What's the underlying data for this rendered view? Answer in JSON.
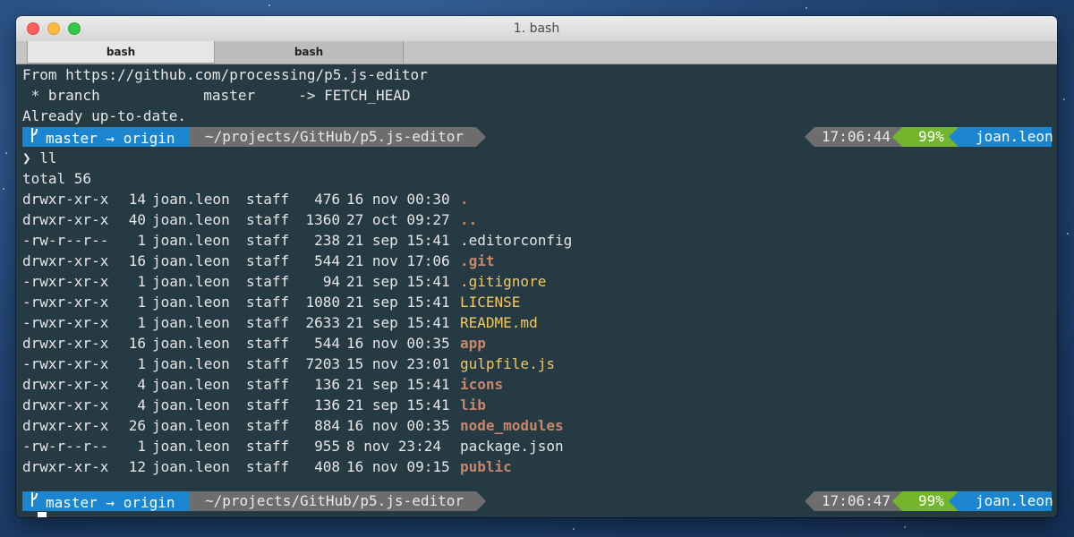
{
  "window": {
    "title": "1. bash"
  },
  "tabs": [
    {
      "label": "bash",
      "active": true
    },
    {
      "label": "bash",
      "active": false
    }
  ],
  "terminal": {
    "git_output": [
      "From https://github.com/processing/p5.js-editor",
      " * branch            master     -> FETCH_HEAD",
      "Already up-to-date."
    ],
    "prompt1": {
      "branch": "master → origin",
      "path": "~/projects/GitHub/p5.js-editor",
      "time": "17:06:44",
      "battery": "99%",
      "user": "joan.leon"
    },
    "command": {
      "arrow": "❯",
      "text": "ll"
    },
    "total": "total 56",
    "listing": [
      {
        "perm": "drwxr-xr-x",
        "links": "14",
        "owner": "joan.leon",
        "group": "staff",
        "size": "476",
        "date": "16 nov 00:30",
        "name": ".",
        "kind": "dir"
      },
      {
        "perm": "drwxr-xr-x",
        "links": "40",
        "owner": "joan.leon",
        "group": "staff",
        "size": "1360",
        "date": "27 oct 09:27",
        "name": "..",
        "kind": "dir"
      },
      {
        "perm": "-rw-r--r--",
        "links": "1",
        "owner": "joan.leon",
        "group": "staff",
        "size": "238",
        "date": "21 sep 15:41",
        "name": ".editorconfig",
        "kind": "plain"
      },
      {
        "perm": "drwxr-xr-x",
        "links": "16",
        "owner": "joan.leon",
        "group": "staff",
        "size": "544",
        "date": "21 nov 17:06",
        "name": ".git",
        "kind": "dir"
      },
      {
        "perm": "-rwxr-xr-x",
        "links": "1",
        "owner": "joan.leon",
        "group": "staff",
        "size": "94",
        "date": "21 sep 15:41",
        "name": ".gitignore",
        "kind": "exe"
      },
      {
        "perm": "-rwxr-xr-x",
        "links": "1",
        "owner": "joan.leon",
        "group": "staff",
        "size": "1080",
        "date": "21 sep 15:41",
        "name": "LICENSE",
        "kind": "exe"
      },
      {
        "perm": "-rwxr-xr-x",
        "links": "1",
        "owner": "joan.leon",
        "group": "staff",
        "size": "2633",
        "date": "21 sep 15:41",
        "name": "README.md",
        "kind": "exe"
      },
      {
        "perm": "drwxr-xr-x",
        "links": "16",
        "owner": "joan.leon",
        "group": "staff",
        "size": "544",
        "date": "16 nov 00:35",
        "name": "app",
        "kind": "dir"
      },
      {
        "perm": "-rwxr-xr-x",
        "links": "1",
        "owner": "joan.leon",
        "group": "staff",
        "size": "7203",
        "date": "15 nov 23:01",
        "name": "gulpfile.js",
        "kind": "exe"
      },
      {
        "perm": "drwxr-xr-x",
        "links": "4",
        "owner": "joan.leon",
        "group": "staff",
        "size": "136",
        "date": "21 sep 15:41",
        "name": "icons",
        "kind": "dir"
      },
      {
        "perm": "drwxr-xr-x",
        "links": "4",
        "owner": "joan.leon",
        "group": "staff",
        "size": "136",
        "date": "21 sep 15:41",
        "name": "lib",
        "kind": "dir"
      },
      {
        "perm": "drwxr-xr-x",
        "links": "26",
        "owner": "joan.leon",
        "group": "staff",
        "size": "884",
        "date": "16 nov 00:35",
        "name": "node_modules",
        "kind": "dir"
      },
      {
        "perm": "-rw-r--r--",
        "links": "1",
        "owner": "joan.leon",
        "group": "staff",
        "size": "955",
        "date": "8 nov 23:24",
        "name": "package.json",
        "kind": "plain"
      },
      {
        "perm": "drwxr-xr-x",
        "links": "12",
        "owner": "joan.leon",
        "group": "staff",
        "size": "408",
        "date": "16 nov 09:15",
        "name": "public",
        "kind": "dir"
      }
    ],
    "prompt2": {
      "branch": "master → origin",
      "path": "~/projects/GitHub/p5.js-editor",
      "time": "17:06:47",
      "battery": "99%",
      "user": "joan.leon"
    },
    "final_prompt": {
      "arrow": "❯"
    }
  },
  "colors": {
    "terminal_bg": "#263a44",
    "segment_blue": "#1b86cf",
    "segment_gray": "#6d6d6d",
    "segment_green": "#73b52d",
    "directory": "#c6876b",
    "executable": "#f2c95c"
  },
  "icons": {
    "branch": "git-branch-icon"
  }
}
